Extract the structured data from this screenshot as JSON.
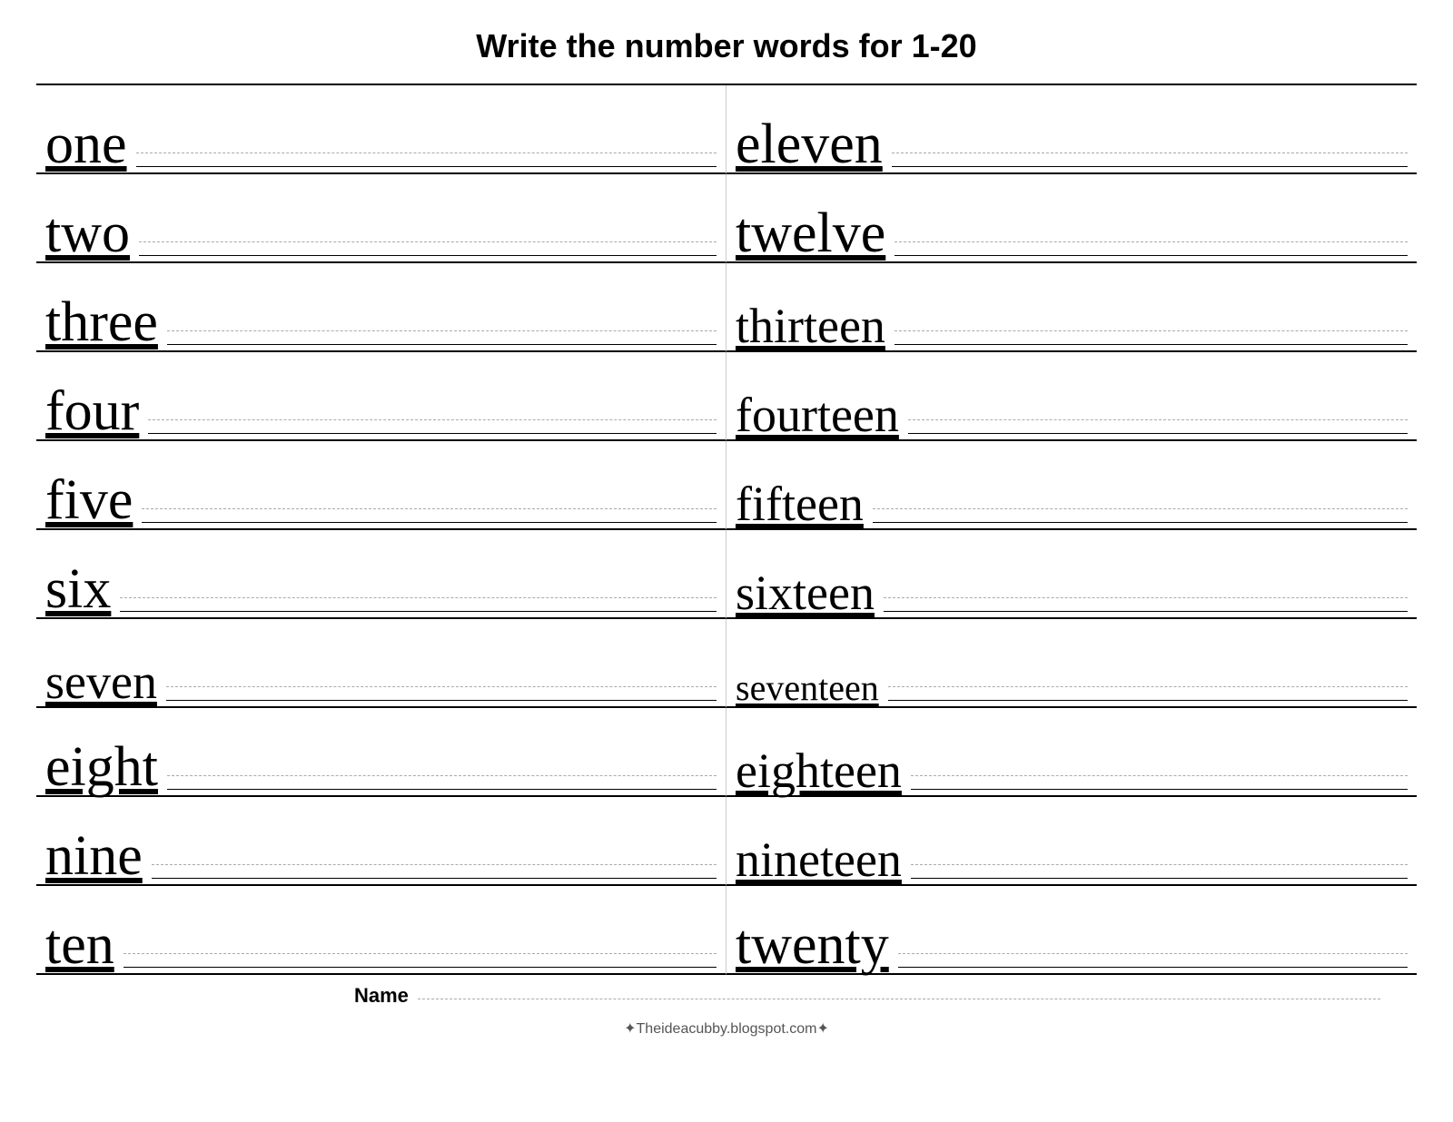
{
  "title": "Write the number words for  1-20",
  "words_left": [
    "one",
    "two",
    "three",
    "four",
    "five",
    "six",
    "seven",
    "eight",
    "nine",
    "ten"
  ],
  "words_right": [
    "eleven",
    "twelve",
    "thirteen",
    "fourteen",
    "fifteen",
    "sixteen",
    "seventeen",
    "eighteen",
    "nineteen",
    "twenty"
  ],
  "name_label": "Name",
  "footer": "✦Theideacubby.blogspot.com✦"
}
